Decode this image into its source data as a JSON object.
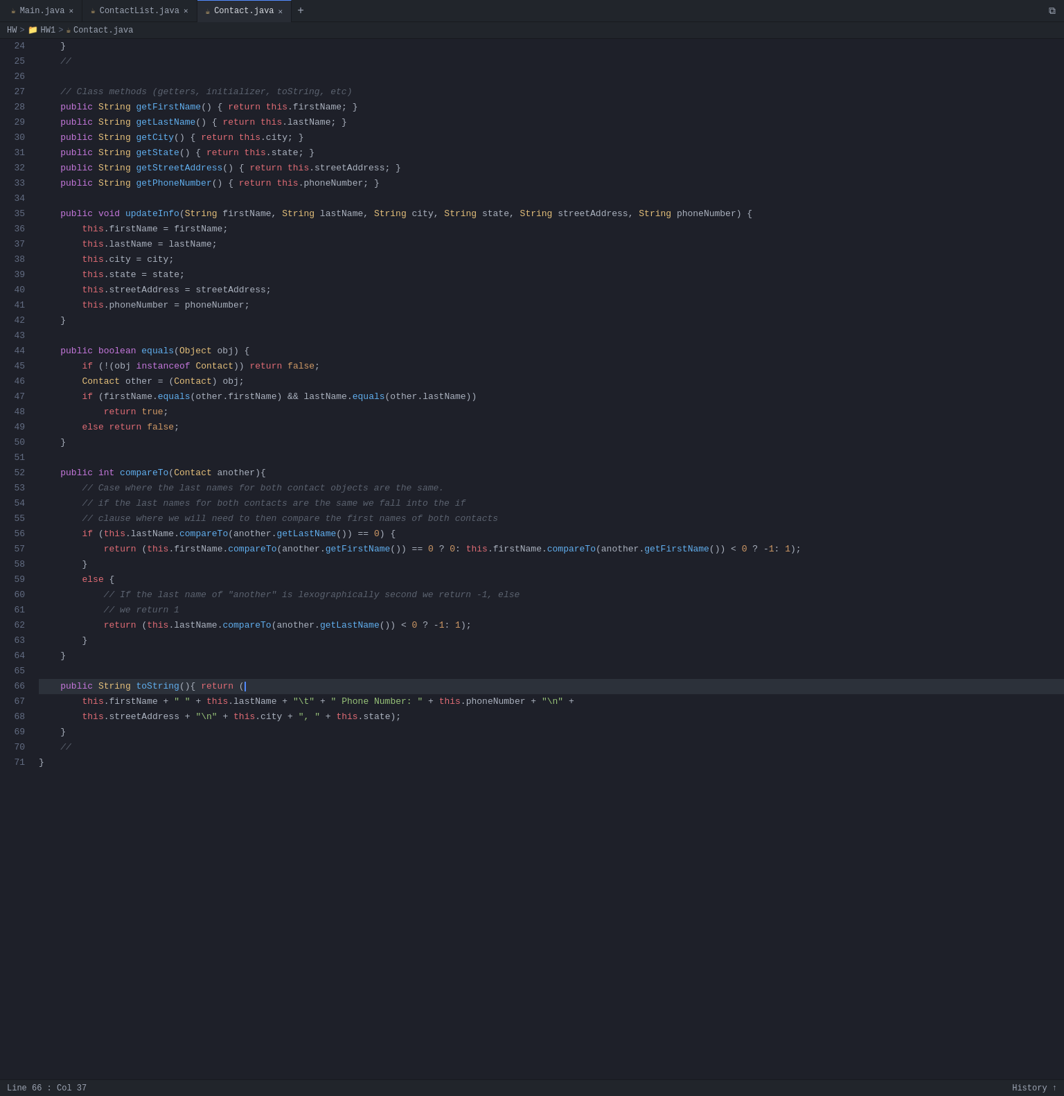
{
  "tabs": [
    {
      "label": "Main.java",
      "active": false,
      "icon_color": "#e5c07b"
    },
    {
      "label": "ContactList.java",
      "active": false,
      "icon_color": "#e5c07b"
    },
    {
      "label": "Contact.java",
      "active": true,
      "icon_color": "#e5c07b"
    }
  ],
  "breadcrumb": [
    "HW",
    "HW1",
    "Contact.java"
  ],
  "status": {
    "left": "Line 66 : Col 37",
    "right": "History ↑"
  },
  "lines": [
    {
      "num": 24,
      "text": "    }"
    },
    {
      "num": 25,
      "text": "    //"
    },
    {
      "num": 26,
      "text": ""
    },
    {
      "num": 27,
      "text": "    // Class methods (getters, initializer, toString, etc)"
    },
    {
      "num": 28,
      "text": "    public String getFirstName() { return this.firstName; }"
    },
    {
      "num": 29,
      "text": "    public String getLastName() { return this.lastName; }"
    },
    {
      "num": 30,
      "text": "    public String getCity() { return this.city; }"
    },
    {
      "num": 31,
      "text": "    public String getState() { return this.state; }"
    },
    {
      "num": 32,
      "text": "    public String getStreetAddress() { return this.streetAddress; }"
    },
    {
      "num": 33,
      "text": "    public String getPhoneNumber() { return this.phoneNumber; }"
    },
    {
      "num": 34,
      "text": ""
    },
    {
      "num": 35,
      "text": "    public void updateInfo(String firstName, String lastName, String city, String state, String streetAddress, String phoneNumber) {"
    },
    {
      "num": 36,
      "text": "        this.firstName = firstName;"
    },
    {
      "num": 37,
      "text": "        this.lastName = lastName;"
    },
    {
      "num": 38,
      "text": "        this.city = city;"
    },
    {
      "num": 39,
      "text": "        this.state = state;"
    },
    {
      "num": 40,
      "text": "        this.streetAddress = streetAddress;"
    },
    {
      "num": 41,
      "text": "        this.phoneNumber = phoneNumber;"
    },
    {
      "num": 42,
      "text": "    }"
    },
    {
      "num": 43,
      "text": ""
    },
    {
      "num": 44,
      "text": "    public boolean equals(Object obj) {"
    },
    {
      "num": 45,
      "text": "        if (!(obj instanceof Contact)) return false;"
    },
    {
      "num": 46,
      "text": "        Contact other = (Contact) obj;"
    },
    {
      "num": 47,
      "text": "        if (firstName.equals(other.firstName) && lastName.equals(other.lastName))"
    },
    {
      "num": 48,
      "text": "            return true;"
    },
    {
      "num": 49,
      "text": "        else return false;"
    },
    {
      "num": 50,
      "text": "    }"
    },
    {
      "num": 51,
      "text": ""
    },
    {
      "num": 52,
      "text": "    public int compareTo(Contact another){"
    },
    {
      "num": 53,
      "text": "        // Case where the last names for both contact objects are the same."
    },
    {
      "num": 54,
      "text": "        // if the last names for both contacts are the same we fall into the if"
    },
    {
      "num": 55,
      "text": "        // clause where we will need to then compare the first names of both contacts"
    },
    {
      "num": 56,
      "text": "        if (this.lastName.compareTo(another.getLastName()) == 0) {"
    },
    {
      "num": 57,
      "text": "            return (this.firstName.compareTo(another.getFirstName()) == 0 ? 0: this.firstName.compareTo(another.getFirstName()) < 0 ? -1: 1);"
    },
    {
      "num": 58,
      "text": "        }"
    },
    {
      "num": 59,
      "text": "        else {"
    },
    {
      "num": 60,
      "text": "            // If the last name of \"another\" is lexographically second we return -1, else"
    },
    {
      "num": 61,
      "text": "            // we return 1"
    },
    {
      "num": 62,
      "text": "            return (this.lastName.compareTo(another.getLastName()) < 0 ? -1: 1);"
    },
    {
      "num": 63,
      "text": "        }"
    },
    {
      "num": 64,
      "text": "    }"
    },
    {
      "num": 65,
      "text": ""
    },
    {
      "num": 66,
      "text": "    public String toString(){ return (",
      "active": true
    },
    {
      "num": 67,
      "text": "        this.firstName + \" \" + this.lastName + \"\\t\" + \" Phone Number: \" + this.phoneNumber + \"\\n\" +"
    },
    {
      "num": 68,
      "text": "        this.streetAddress + \"\\n\" + this.city + \", \" + this.state);"
    },
    {
      "num": 69,
      "text": "    }"
    },
    {
      "num": 70,
      "text": "    //"
    },
    {
      "num": 71,
      "text": "}"
    }
  ]
}
